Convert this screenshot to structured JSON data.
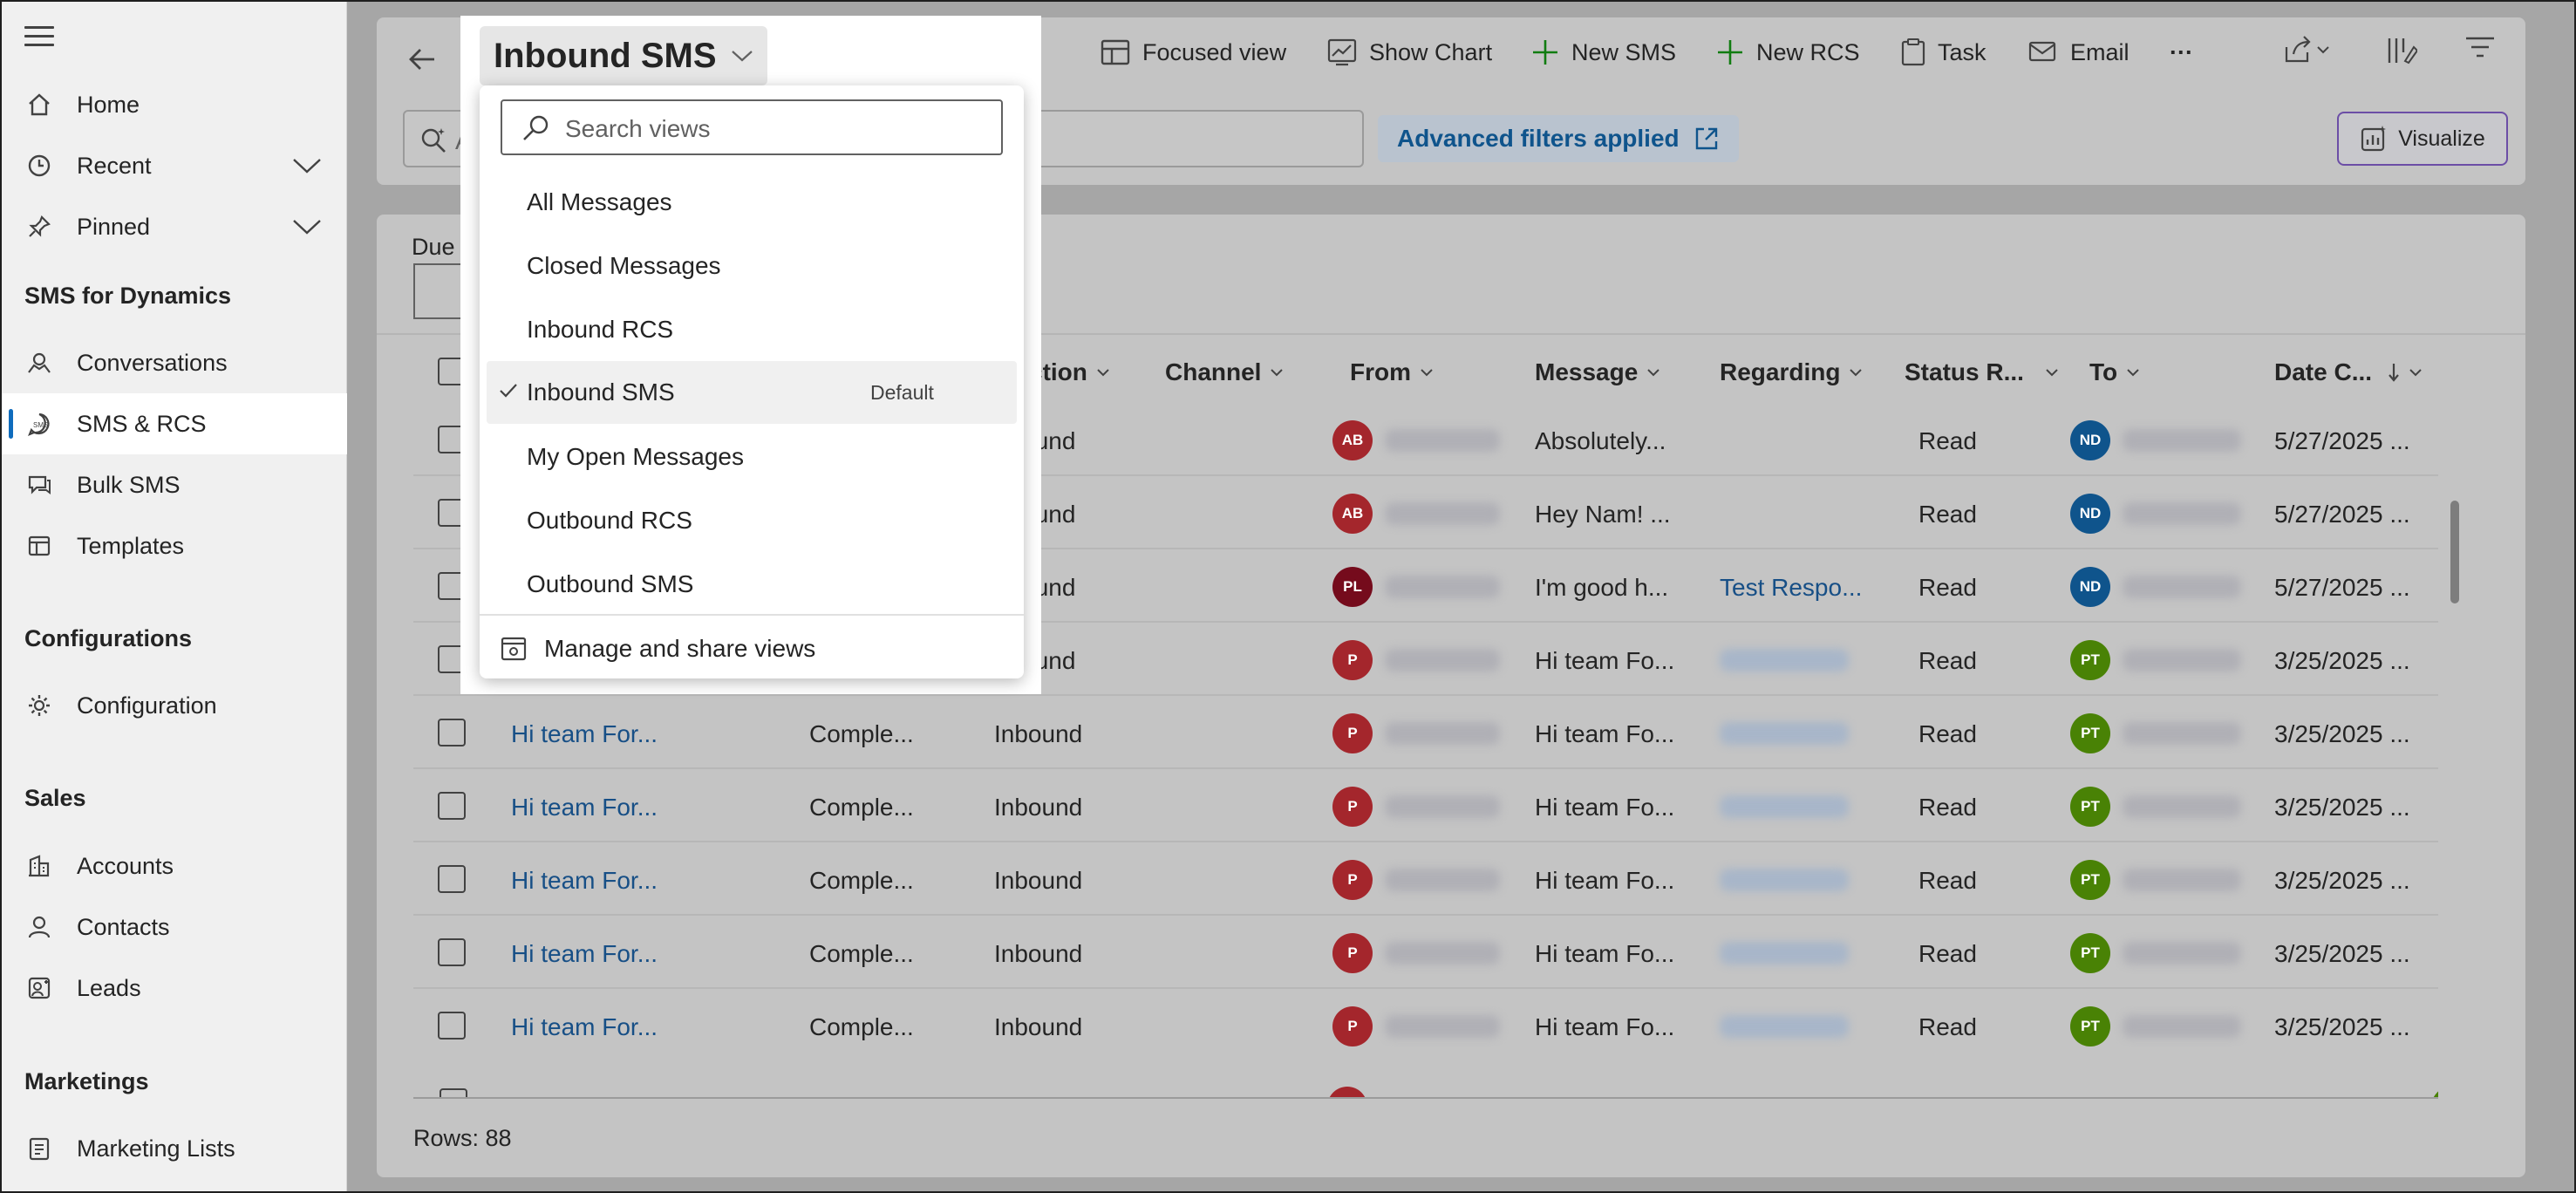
{
  "sidebar": {
    "items": [
      {
        "label": "Home",
        "icon": "home-icon"
      },
      {
        "label": "Recent",
        "icon": "clock-icon"
      },
      {
        "label": "Pinned",
        "icon": "pin-icon"
      },
      {
        "label": "Conversations",
        "icon": "conversation-icon"
      },
      {
        "label": "SMS & RCS",
        "icon": "sms-icon"
      },
      {
        "label": "Bulk SMS",
        "icon": "bulk-sms-icon"
      },
      {
        "label": "Templates",
        "icon": "template-icon"
      },
      {
        "label": "Configuration",
        "icon": "gear-icon"
      },
      {
        "label": "Accounts",
        "icon": "building-icon"
      },
      {
        "label": "Contacts",
        "icon": "person-icon"
      },
      {
        "label": "Leads",
        "icon": "lead-icon"
      },
      {
        "label": "Marketing Lists",
        "icon": "list-icon"
      }
    ],
    "sections": [
      "SMS for Dynamics",
      "Configurations",
      "Sales",
      "Marketings"
    ]
  },
  "commandbar": {
    "focused_view": "Focused view",
    "show_chart": "Show Chart",
    "new_sms": "New SMS",
    "new_rcs": "New RCS",
    "task": "Task",
    "email": "Email",
    "more": "···",
    "advanced_filters": "Advanced filters applied",
    "visualize": "Visualize",
    "search_placeholder": "As"
  },
  "view_selector": {
    "title": "Inbound SMS",
    "search_placeholder": "Search views",
    "items": [
      "All Messages",
      "Closed Messages",
      "Inbound RCS",
      "Inbound SMS",
      "My Open Messages",
      "Outbound RCS",
      "Outbound SMS"
    ],
    "default_label": "Default",
    "manage": "Manage and share views"
  },
  "filters": {
    "due_label": "Due"
  },
  "grid": {
    "columns": [
      "ction",
      "Channel",
      "From",
      "Message",
      "Regarding",
      "Status R...",
      "To",
      "Date C..."
    ],
    "rows": [
      {
        "subject": "",
        "status": "",
        "direction": "nbound",
        "from_initials": "AB",
        "from_color": "#a4262c",
        "message": "Absolutely...",
        "regarding": "",
        "regarding_blurred": false,
        "status_reason": "Read",
        "to_initials": "ND",
        "to_color": "#0f548c",
        "date": "5/27/2025 ..."
      },
      {
        "subject": "",
        "status": "",
        "direction": "nbound",
        "from_initials": "AB",
        "from_color": "#a4262c",
        "message": "Hey Nam! ...",
        "regarding": "",
        "regarding_blurred": false,
        "status_reason": "Read",
        "to_initials": "ND",
        "to_color": "#0f548c",
        "date": "5/27/2025 ..."
      },
      {
        "subject": "",
        "status": "",
        "direction": "nbound",
        "from_initials": "PL",
        "from_color": "#750b1c",
        "message": "I'm good h...",
        "regarding": "Test Respo...",
        "regarding_blurred": false,
        "status_reason": "Read",
        "to_initials": "ND",
        "to_color": "#0f548c",
        "date": "5/27/2025 ..."
      },
      {
        "subject": "",
        "status": "",
        "direction": "nbound",
        "from_initials": "P",
        "from_color": "#a4262c",
        "message": "Hi team Fo...",
        "regarding": "",
        "regarding_blurred": true,
        "status_reason": "Read",
        "to_initials": "PT",
        "to_color": "#498205",
        "date": "3/25/2025 ..."
      },
      {
        "subject": "Hi team For...",
        "status": "Comple...",
        "direction": "Inbound",
        "from_initials": "P",
        "from_color": "#a4262c",
        "message": "Hi team Fo...",
        "regarding": "",
        "regarding_blurred": true,
        "status_reason": "Read",
        "to_initials": "PT",
        "to_color": "#498205",
        "date": "3/25/2025 ..."
      },
      {
        "subject": "Hi team For...",
        "status": "Comple...",
        "direction": "Inbound",
        "from_initials": "P",
        "from_color": "#a4262c",
        "message": "Hi team Fo...",
        "regarding": "",
        "regarding_blurred": true,
        "status_reason": "Read",
        "to_initials": "PT",
        "to_color": "#498205",
        "date": "3/25/2025 ..."
      },
      {
        "subject": "Hi team For...",
        "status": "Comple...",
        "direction": "Inbound",
        "from_initials": "P",
        "from_color": "#a4262c",
        "message": "Hi team Fo...",
        "regarding": "",
        "regarding_blurred": true,
        "status_reason": "Read",
        "to_initials": "PT",
        "to_color": "#498205",
        "date": "3/25/2025 ..."
      },
      {
        "subject": "Hi team For...",
        "status": "Comple...",
        "direction": "Inbound",
        "from_initials": "P",
        "from_color": "#a4262c",
        "message": "Hi team Fo...",
        "regarding": "",
        "regarding_blurred": true,
        "status_reason": "Read",
        "to_initials": "PT",
        "to_color": "#498205",
        "date": "3/25/2025 ..."
      },
      {
        "subject": "Hi team For...",
        "status": "Comple...",
        "direction": "Inbound",
        "from_initials": "P",
        "from_color": "#a4262c",
        "message": "Hi team Fo...",
        "regarding": "",
        "regarding_blurred": true,
        "status_reason": "Read",
        "to_initials": "PT",
        "to_color": "#498205",
        "date": "3/25/2025 ..."
      }
    ],
    "rows_count": "Rows: 88"
  },
  "colors": {
    "accent": "#0f6cbd",
    "link": "#174f86",
    "overlay": "#a6a6a6"
  }
}
